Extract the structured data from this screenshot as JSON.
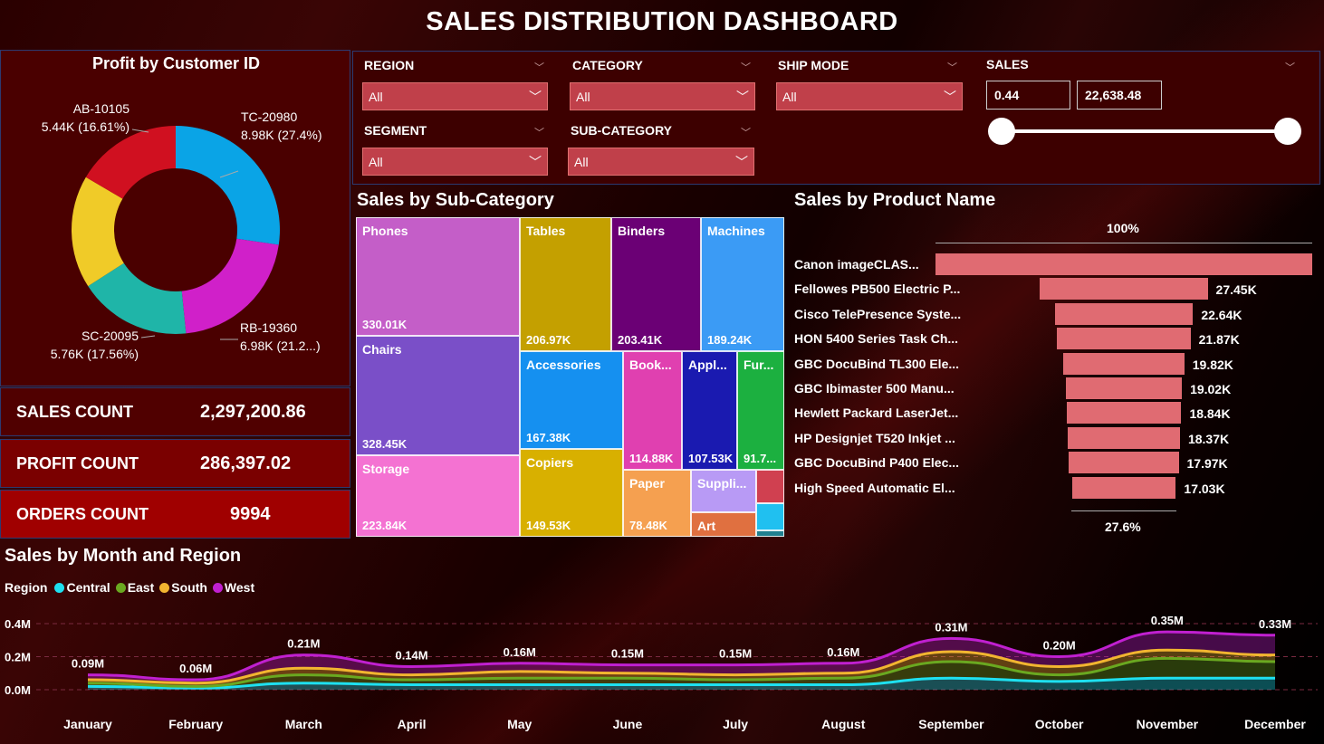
{
  "title": "SALES DISTRIBUTION DASHBOARD",
  "donut": {
    "title": "Profit by Customer ID",
    "slices": [
      {
        "id": "TC-20980",
        "label": "8.98K (27.4%)",
        "value": 27.4,
        "color": "#0aa4e6"
      },
      {
        "id": "RB-19360",
        "label": "6.98K (21.2...)",
        "value": 21.2,
        "color": "#d020c9"
      },
      {
        "id": "SC-20095",
        "label": "5.76K (17.56%)",
        "value": 17.56,
        "color": "#1fb5a8"
      },
      {
        "id": "",
        "label": "",
        "value": 17.6,
        "color": "#f0cb28"
      },
      {
        "id": "AB-10105",
        "label": "5.44K (16.61%)",
        "value": 16.61,
        "color": "#d01020"
      }
    ]
  },
  "kpis": [
    {
      "label": "SALES COUNT",
      "value": "2,297,200.86"
    },
    {
      "label": "PROFIT COUNT",
      "value": "286,397.02"
    },
    {
      "label": "ORDERS COUNT",
      "value": "9994"
    }
  ],
  "filters": {
    "region": {
      "label": "REGION",
      "value": "All"
    },
    "category": {
      "label": "CATEGORY",
      "value": "All"
    },
    "ship_mode": {
      "label": "SHIP MODE",
      "value": "All"
    },
    "segment": {
      "label": "SEGMENT",
      "value": "All"
    },
    "sub_category": {
      "label": "SUB-CATEGORY",
      "value": "All"
    },
    "sales": {
      "label": "SALES",
      "min": "0.44",
      "max": "22,638.48"
    }
  },
  "treemap": {
    "title": "Sales by Sub-Category",
    "items": [
      {
        "name": "Phones",
        "value": "330.01K",
        "color": "#c45ec8"
      },
      {
        "name": "Chairs",
        "value": "328.45K",
        "color": "#7a4fc8"
      },
      {
        "name": "Storage",
        "value": "223.84K",
        "color": "#f472d2"
      },
      {
        "name": "Tables",
        "value": "206.97K",
        "color": "#c4a000"
      },
      {
        "name": "Binders",
        "value": "203.41K",
        "color": "#6b0075"
      },
      {
        "name": "Machines",
        "value": "189.24K",
        "color": "#3b9bf5"
      },
      {
        "name": "Accessories",
        "value": "167.38K",
        "color": "#1590f0"
      },
      {
        "name": "Copiers",
        "value": "149.53K",
        "color": "#d8b000"
      },
      {
        "name": "Book...",
        "value": "114.88K",
        "color": "#e040b0"
      },
      {
        "name": "Appl...",
        "value": "107.53K",
        "color": "#1a1ab0"
      },
      {
        "name": "Fur...",
        "value": "91.7...",
        "color": "#1cb040"
      },
      {
        "name": "Paper",
        "value": "78.48K",
        "color": "#f5a050"
      },
      {
        "name": "Suppli...",
        "value": "",
        "color": "#b89af5"
      },
      {
        "name": "Art",
        "value": "",
        "color": "#e07040"
      },
      {
        "name": "",
        "value": "",
        "color": "#d04050"
      },
      {
        "name": "",
        "value": "",
        "color": "#20c0f0"
      },
      {
        "name": "",
        "value": "",
        "color": "#208090"
      }
    ]
  },
  "funnel": {
    "title": "Sales by Product Name",
    "top_pct": "100%",
    "bottom_pct": "27.6%",
    "items": [
      {
        "name": "Canon imageCLAS...",
        "value": "",
        "ratio": 1.0
      },
      {
        "name": "Fellowes PB500 Electric P...",
        "value": "27.45K",
        "ratio": 0.445
      },
      {
        "name": "Cisco TelePresence Syste...",
        "value": "22.64K",
        "ratio": 0.367
      },
      {
        "name": "HON 5400 Series Task Ch...",
        "value": "21.87K",
        "ratio": 0.354
      },
      {
        "name": "GBC DocuBind TL300 Ele...",
        "value": "19.82K",
        "ratio": 0.321
      },
      {
        "name": "GBC Ibimaster 500 Manu...",
        "value": "19.02K",
        "ratio": 0.308
      },
      {
        "name": "Hewlett Packard LaserJet...",
        "value": "18.84K",
        "ratio": 0.305
      },
      {
        "name": "HP Designjet T520 Inkjet ...",
        "value": "18.37K",
        "ratio": 0.298
      },
      {
        "name": "GBC DocuBind P400 Elec...",
        "value": "17.97K",
        "ratio": 0.291
      },
      {
        "name": "High Speed Automatic El...",
        "value": "17.03K",
        "ratio": 0.276
      }
    ]
  },
  "chart_data": {
    "type": "area",
    "title": "Sales by Month and Region",
    "legend_title": "Region",
    "legend_position": "top-left",
    "categories": [
      "January",
      "February",
      "March",
      "April",
      "May",
      "June",
      "July",
      "August",
      "September",
      "October",
      "November",
      "December"
    ],
    "totals_labels": [
      "0.09M",
      "0.06M",
      "0.21M",
      "0.14M",
      "0.16M",
      "0.15M",
      "0.15M",
      "0.16M",
      "0.31M",
      "0.20M",
      "0.35M",
      "0.33M"
    ],
    "yticks": [
      "0.4M",
      "0.2M",
      "0.0M"
    ],
    "ylim": [
      0,
      0.4
    ],
    "series": [
      {
        "name": "Central",
        "color": "#1ee0f0",
        "values": [
          0.02,
          0.01,
          0.04,
          0.03,
          0.03,
          0.03,
          0.03,
          0.03,
          0.07,
          0.05,
          0.07,
          0.07
        ]
      },
      {
        "name": "East",
        "color": "#6aa820",
        "values": [
          0.02,
          0.01,
          0.05,
          0.03,
          0.04,
          0.04,
          0.03,
          0.04,
          0.1,
          0.04,
          0.12,
          0.1
        ]
      },
      {
        "name": "South",
        "color": "#f2b530",
        "values": [
          0.02,
          0.02,
          0.04,
          0.03,
          0.04,
          0.03,
          0.03,
          0.03,
          0.06,
          0.05,
          0.05,
          0.04
        ]
      },
      {
        "name": "West",
        "color": "#c020d0",
        "values": [
          0.03,
          0.02,
          0.08,
          0.05,
          0.05,
          0.05,
          0.06,
          0.06,
          0.08,
          0.06,
          0.11,
          0.12
        ]
      }
    ]
  }
}
